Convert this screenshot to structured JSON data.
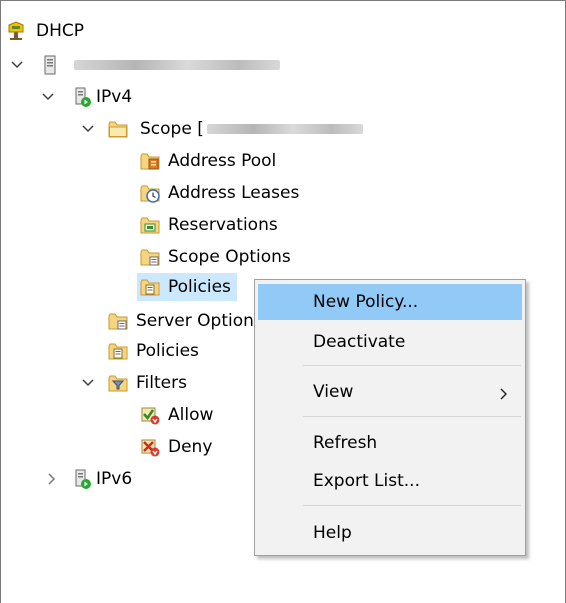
{
  "tree": {
    "root": {
      "label": "DHCP",
      "icon": "dhcp-icon"
    },
    "server": {
      "label": "",
      "icon": "server-icon",
      "redacted": true
    },
    "ipv4": {
      "label": "IPv4",
      "icon": "ipv4-icon"
    },
    "scope": {
      "label": "Scope [",
      "icon": "folder-icon",
      "redacted": true
    },
    "scope_children": [
      {
        "label": "Address Pool",
        "icon": "address-pool-icon"
      },
      {
        "label": "Address Leases",
        "icon": "address-leases-icon"
      },
      {
        "label": "Reservations",
        "icon": "reservations-icon"
      },
      {
        "label": "Scope Options",
        "icon": "scope-options-icon"
      },
      {
        "label": "Policies",
        "icon": "policies-icon",
        "selected": true
      }
    ],
    "server_options": {
      "label": "Server Options",
      "icon": "server-options-icon"
    },
    "policies": {
      "label": "Policies",
      "icon": "policies-icon"
    },
    "filters": {
      "label": "Filters",
      "icon": "filters-icon"
    },
    "filter_children": [
      {
        "label": "Allow",
        "icon": "allow-filter-icon"
      },
      {
        "label": "Deny",
        "icon": "deny-filter-icon"
      }
    ],
    "ipv6": {
      "label": "IPv6",
      "icon": "ipv6-icon"
    }
  },
  "context_menu": {
    "items": [
      {
        "label": "New Policy...",
        "highlighted": true
      },
      {
        "label": "Deactivate"
      },
      {
        "label": "View",
        "submenu": true
      },
      {
        "label": "Refresh"
      },
      {
        "label": "Export List..."
      },
      {
        "label": "Help"
      }
    ]
  },
  "colors": {
    "selection": "#cce8ff",
    "menu_highlight": "#91c9f7",
    "menu_background": "#f2f2f2"
  }
}
